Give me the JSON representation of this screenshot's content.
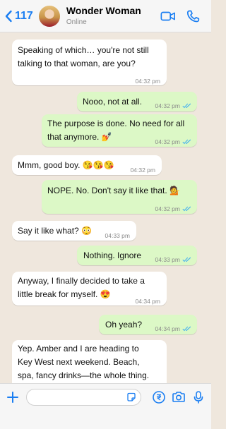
{
  "header": {
    "back_count": "117",
    "contact_name": "Wonder Woman",
    "status": "Online"
  },
  "messages": [
    {
      "dir": "in",
      "text_lines": [
        "Speaking of which… you're not still",
        "talking to that woman, are you?"
      ],
      "time": "04:32 pm"
    },
    {
      "dir": "out",
      "text_lines": [
        "Nooo, not at all."
      ],
      "time": "04:32 pm"
    },
    {
      "dir": "out",
      "text_lines": [
        "The purpose is done. No need for all",
        "that anymore. 💅"
      ],
      "time": "04:32 pm"
    },
    {
      "dir": "in",
      "text_lines": [
        "Mmm, good boy. 😘😘😘"
      ],
      "time": "04:32 pm"
    },
    {
      "dir": "out",
      "text_lines": [
        "NOPE. No. Don't say it like that. 💁"
      ],
      "time": "04:32 pm"
    },
    {
      "dir": "in",
      "text_lines": [
        "Say it like what? 😳"
      ],
      "time": "04:33 pm"
    },
    {
      "dir": "out",
      "text_lines": [
        "Nothing. Ignore"
      ],
      "time": "04:33 pm"
    },
    {
      "dir": "in",
      "text_lines": [
        "Anyway, I finally decided to take a",
        "little break for myself. 😍"
      ],
      "time": "04:34 pm"
    },
    {
      "dir": "out",
      "text_lines": [
        "Oh yeah?"
      ],
      "time": "04:34 pm"
    },
    {
      "dir": "in",
      "text_lines": [
        "Yep. Amber and I are heading to",
        "Key West next weekend. Beach,",
        "spa, fancy drinks—the whole thing."
      ],
      "time": ""
    }
  ],
  "colors": {
    "accent": "#1a7ef2",
    "incoming_bubble": "#ffffff",
    "outgoing_bubble": "#dcf8c6",
    "read_ticks": "#4fb6ec",
    "chat_background": "#efe7dd"
  },
  "icons": {
    "header": [
      "back-chevron-icon",
      "video-call-icon",
      "phone-icon"
    ],
    "input": [
      "plus-icon",
      "sticker-icon",
      "rupee-payment-icon",
      "camera-icon",
      "microphone-icon"
    ]
  }
}
